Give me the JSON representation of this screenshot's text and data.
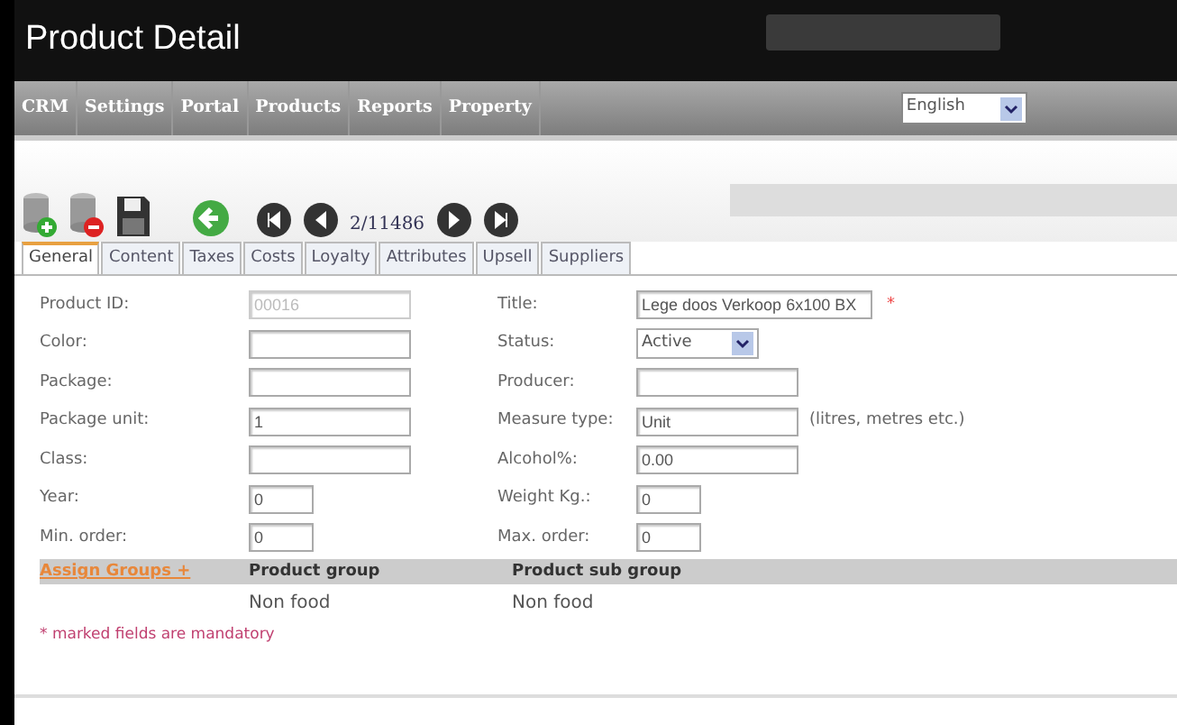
{
  "window": {
    "title": "Product Detail"
  },
  "menu": [
    {
      "label": "CRM"
    },
    {
      "label": "Settings"
    },
    {
      "label": "Portal"
    },
    {
      "label": "Products"
    },
    {
      "label": "Reports"
    },
    {
      "label": "Property"
    }
  ],
  "language": {
    "value": "English"
  },
  "toolbar": {
    "counter": "2/11486"
  },
  "tabs": [
    {
      "label": "General",
      "selected": true
    },
    {
      "label": "Content",
      "selected": false
    },
    {
      "label": "Taxes",
      "selected": false
    },
    {
      "label": "Costs",
      "selected": false
    },
    {
      "label": "Loyalty",
      "selected": false
    },
    {
      "label": "Attributes",
      "selected": false
    },
    {
      "label": "Upsell",
      "selected": false
    },
    {
      "label": "Suppliers",
      "selected": false
    }
  ],
  "left_fields": [
    {
      "label": "Product ID:",
      "kind": "text",
      "value": "00016",
      "disabled": true,
      "required": false
    },
    {
      "label": "Color:",
      "kind": "text",
      "disabled": false,
      "required": false
    },
    {
      "label": "Package:",
      "kind": "text",
      "disabled": false,
      "required": false
    },
    {
      "label": "Package unit:",
      "kind": "text",
      "value": "1",
      "disabled": false,
      "required": false
    },
    {
      "label": "Class:",
      "kind": "text",
      "disabled": false,
      "required": false
    },
    {
      "label": "Year:",
      "kind": "number",
      "value": "0",
      "disabled": false,
      "required": false
    },
    {
      "label": "Min. order:",
      "kind": "number",
      "value": "0",
      "disabled": false,
      "required": false
    }
  ],
  "right_fields": [
    {
      "label": "Title:",
      "kind": "text",
      "value": "Lege doos Verkoop 6x100 BX",
      "disabled": false,
      "required": true,
      "required_mark": "*"
    },
    {
      "label": "Status:",
      "kind": "select",
      "value": "Active",
      "disabled": false,
      "required": false
    },
    {
      "label": "Producer:",
      "kind": "text",
      "disabled": false,
      "required": false
    },
    {
      "label": "Measure type:",
      "kind": "text",
      "value": "Unit",
      "disabled": false,
      "required": false,
      "hint": "(litres, metres etc.)"
    },
    {
      "label": "Alcohol%:",
      "kind": "text",
      "value": "0.00",
      "disabled": false,
      "required": false
    },
    {
      "label": "Weight Kg.:",
      "kind": "number",
      "value": "0",
      "disabled": false,
      "required": false
    },
    {
      "label": "Max. order:",
      "kind": "number",
      "value": "0",
      "disabled": false,
      "required": false
    }
  ],
  "groups": {
    "assign_link": "Assign Groups +",
    "columns": [
      "Product group",
      "Product sub group"
    ],
    "rows": [
      [
        "Non food",
        "Non food"
      ]
    ]
  },
  "footnote": "* marked fields are mandatory"
}
